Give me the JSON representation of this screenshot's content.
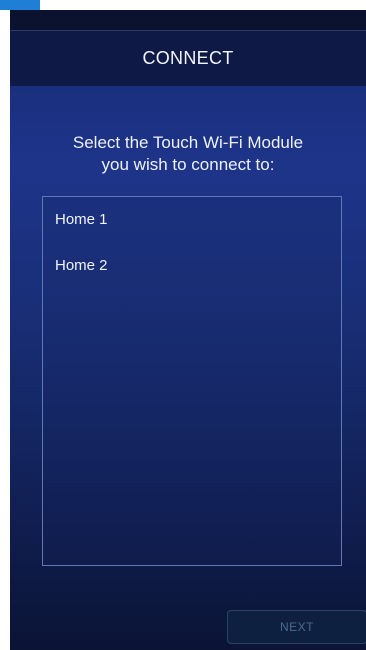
{
  "header": {
    "title": "CONNECT"
  },
  "prompt": {
    "line1": "Select the Touch Wi-Fi Module",
    "line2": "you wish to connect to:"
  },
  "module_list": {
    "items": [
      {
        "label": "Home 1"
      },
      {
        "label": "Home 2"
      }
    ]
  },
  "footer": {
    "next_label": "NEXT"
  },
  "colors": {
    "accent_tab": "#1f7fd6",
    "background_top": "#0f1a3d",
    "background_mid": "#1d3489",
    "list_border": "#5f7ab1",
    "next_text_disabled": "#4b6a8f"
  }
}
